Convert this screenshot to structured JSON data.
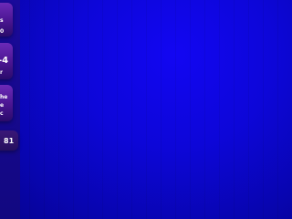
{
  "cards": [
    {
      "line1": "s",
      "line2": "0"
    },
    {
      "value": "-4",
      "sub": "r"
    },
    {
      "line1": "he",
      "line2": "e",
      "line3": "c"
    },
    {
      "value": "81"
    }
  ],
  "colors": {
    "background": "#0d06d8",
    "card": "#4a1590"
  }
}
